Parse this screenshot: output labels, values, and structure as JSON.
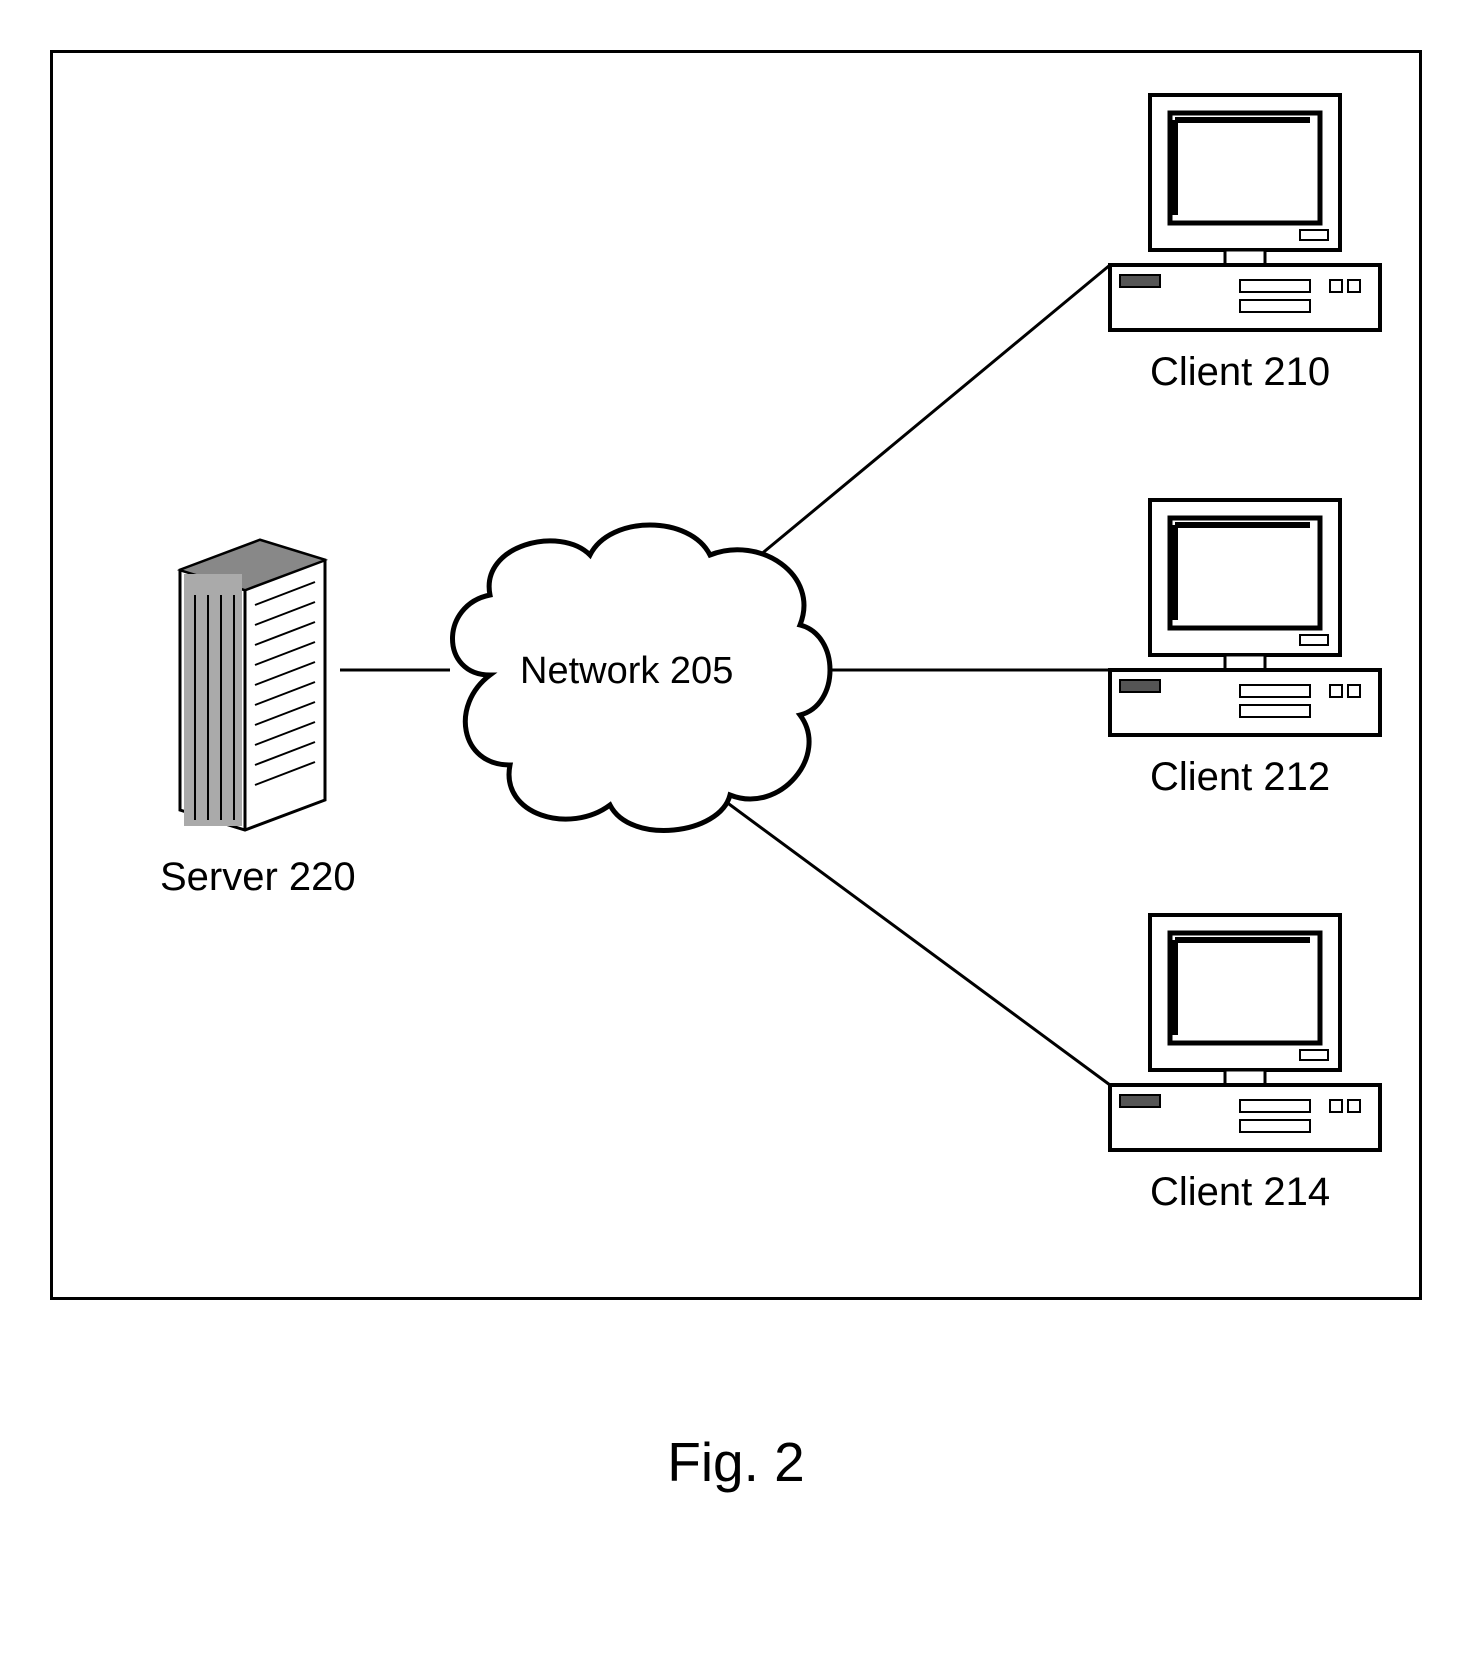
{
  "diagram": {
    "server_label": "Server 220",
    "network_label": "Network 205",
    "client1_label": "Client 210",
    "client2_label": "Client 212",
    "client3_label": "Client 214",
    "figure_caption": "Fig. 2"
  }
}
